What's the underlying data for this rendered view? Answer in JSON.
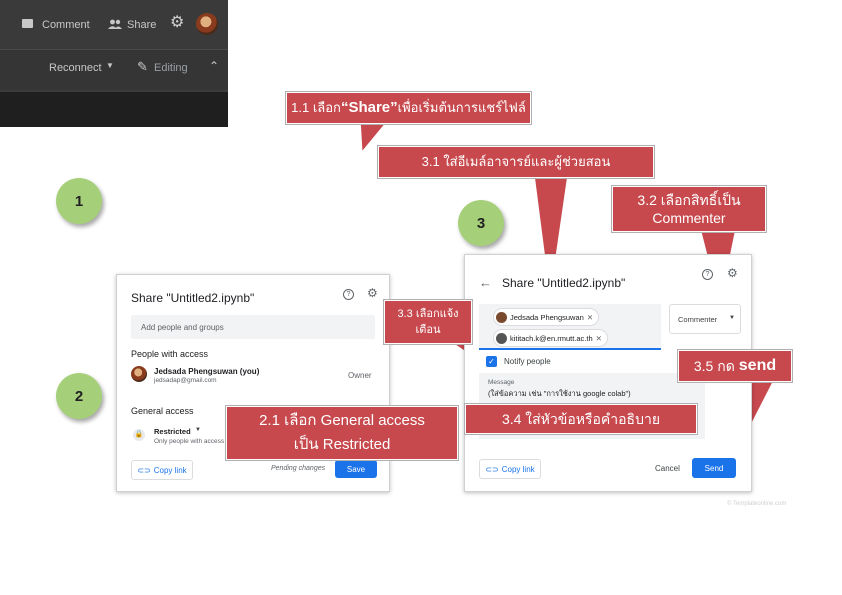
{
  "steps": [
    "1",
    "2",
    "3"
  ],
  "toolbar": {
    "comment_label": "Comment",
    "share_label": "Share",
    "reconnect_label": "Reconnect",
    "editing_label": "Editing"
  },
  "share_dialog_left": {
    "title": "Share \"Untitled2.ipynb\"",
    "add_people_placeholder": "Add people and groups",
    "people_with_access_heading": "People with access",
    "owner_name": "Jedsada Phengsuwan (you)",
    "owner_email": "jedsadap@gmail.com",
    "owner_role": "Owner",
    "general_access_heading": "General access",
    "access_level": "Restricted",
    "access_desc": "Only people with access",
    "copy_link_label": "Copy link",
    "pending_label": "Pending changes",
    "save_label": "Save"
  },
  "share_dialog_right": {
    "title": "Share \"Untitled2.ipynb\"",
    "chip_1": "Jedsada Phengsuwan",
    "chip_2": "kititach.k@en.rmutt.ac.th",
    "role_label": "Commenter",
    "notify_label": "Notify people",
    "message_label": "Message",
    "message_value": "(ใส่ข้อความ เช่น \"การใช้งาน google colab\")",
    "copy_link_label": "Copy link",
    "cancel_label": "Cancel",
    "send_label": "Send"
  },
  "callouts": {
    "c1_1_prefix": "1.1 เลือก ",
    "c1_1_bold": "“Share”",
    "c1_1_suffix": " เพื่อเริ่มต้นการแชร์ไฟล์",
    "c2_1_line1": "2.1 เลือก General access",
    "c2_1_line2": "เป็น Restricted",
    "c3_1": "3.1 ใส่อีเมล์อาจารย์และผู้ช่วยสอน",
    "c3_2_line1": "3.2 เลือกสิทธิ์เป็น",
    "c3_2_line2": "Commenter",
    "c3_3_line1": "3.3 เลือกแจ้ง",
    "c3_3_line2": "เตือน",
    "c3_4": "3.4 ใส่หัวข้อหรือคำอธิบาย",
    "c3_5_prefix": "3.5 กด ",
    "c3_5_bold": "send"
  },
  "watermark": "© Templateonline.com",
  "colors": {
    "callout": "#c7494e",
    "step_circle": "#a6cf7a",
    "primary_blue": "#1a73e8",
    "toolbar_dark": "#3c3c3c"
  }
}
